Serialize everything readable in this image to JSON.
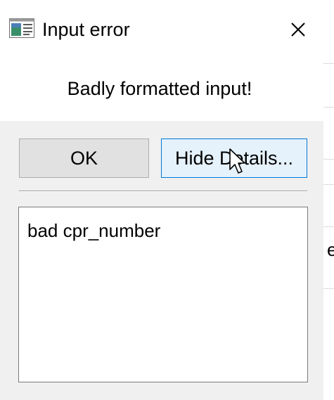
{
  "window": {
    "title": "Input error",
    "icon": "application-window-icon",
    "close_icon": "close-icon"
  },
  "message": "Badly formatted input!",
  "buttons": {
    "ok_label": "OK",
    "details_label": "Hide Details..."
  },
  "details": {
    "text": "bad cpr_number"
  },
  "background": {
    "partial_char": "e"
  },
  "colors": {
    "dialog_bg": "#f0f0f0",
    "focused_button_border": "#0078d7",
    "focused_button_bg": "#e5f1fb"
  }
}
